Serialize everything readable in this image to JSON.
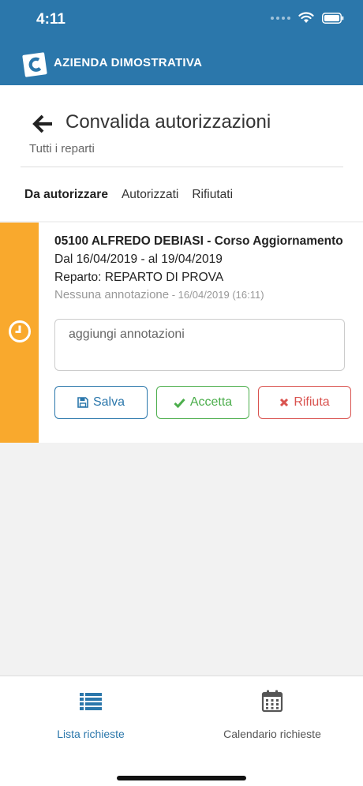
{
  "status_bar": {
    "time": "4:11",
    "icons": [
      "signal-icon",
      "wifi-icon",
      "battery-icon"
    ]
  },
  "header": {
    "company_name": "AZIENDA DIMOSTRATIVA",
    "logo_letter": "C"
  },
  "page": {
    "title": "Convalida autorizzazioni",
    "subtitle": "Tutti i reparti",
    "tabs": [
      {
        "label": "Da autorizzare",
        "active": true
      },
      {
        "label": "Autorizzati",
        "active": false
      },
      {
        "label": "Rifiutati",
        "active": false
      }
    ]
  },
  "request": {
    "title": "05100 ALFREDO DEBIASI - Corso Aggiornamento",
    "dates": "Dal 16/04/2019 - al 19/04/2019",
    "department": "Reparto: REPARTO DI PROVA",
    "note": "Nessuna annotazione",
    "note_date": " - 16/04/2019 (16:11)",
    "status_color": "#f9a92d",
    "notes_placeholder": "aggiungi annotazioni",
    "buttons": {
      "save": "Salva",
      "accept": "Accetta",
      "reject": "Rifiuta"
    }
  },
  "tabbar": {
    "items": [
      {
        "label": "Lista richieste",
        "icon": "list-icon",
        "active": true
      },
      {
        "label": "Calendario richieste",
        "icon": "calendar-icon",
        "active": false
      }
    ]
  },
  "colors": {
    "primary": "#2b77ab",
    "pending": "#f9a92d",
    "accept": "#4cae4c",
    "reject": "#d9534f"
  }
}
